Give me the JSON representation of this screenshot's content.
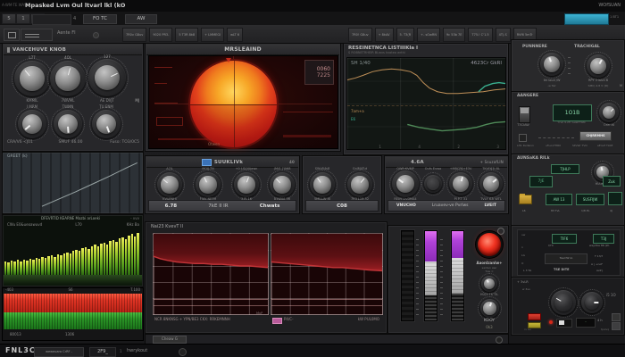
{
  "window": {
    "title_left": "A-WM-TE WAS",
    "title": "Mpasked Lvm Oul ltvarl lkl (kO",
    "title_right": "WOfSUAN"
  },
  "menubar": {
    "segments": [
      "5",
      "1",
      "0"
    ],
    "note": "4",
    "buttons": [
      "FO TC",
      "AW"
    ],
    "accent_color": "#2f9fc4",
    "accent_note": "1 BT1"
  },
  "toolbar": {
    "label": "Aente FI",
    "buttons_left": [
      "7R0v G8uv",
      "9020 PR3-",
      "5 T3R 8k8",
      "+ LMMEGI",
      "wLT 6"
    ],
    "buttons_right": [
      "7R0! G8uv",
      "+ 8kAV",
      "5. T3(R",
      "+- sOwRN",
      "9c 53b 7E",
      "T75.! C'1.5",
      "4T(.S",
      "RVf6 5mTr"
    ]
  },
  "knob_panel": {
    "header": "VANCEHUVE KNOB",
    "row1": [
      {
        "top": "L77",
        "bottom": "KMMIL",
        "angle": -40
      },
      {
        "top": "4OL",
        "bottom": "7WVML",
        "angle": 15
      },
      {
        "top": "127",
        "bottom": "AE DVJT",
        "angle": 65
      }
    ],
    "row1_note": "MJ",
    "row2": [
      {
        "top": "I MRM",
        "angle": -130
      },
      {
        "top": "TWMN",
        "angle": 175
      },
      {
        "top": "TU ENM",
        "angle": 160
      }
    ],
    "footer": [
      "CRA/V6  <J01",
      "SMUF 46.00",
      "Fuso: TO3/0C5"
    ]
  },
  "slope_panel": {
    "label": "GREET (k)"
  },
  "spectrum_panel": {
    "header": "DFEVRTID KEARNE Mazbi arLoeki",
    "corner": "- vvv",
    "sub_left": "CWu E0&ueoawuvd",
    "sub_mid": "L70",
    "sub_right": "KHz Ba"
  },
  "meter_bands": {
    "top_labels": [
      "-403",
      "S6",
      "T.100"
    ],
    "bottom_labels": [
      "80013",
      "1306"
    ],
    "red_color": "#d92c1e",
    "green_color": "#2f9e2f"
  },
  "gonio": {
    "header": "MRSLEAIND",
    "lcd_line1": "0060",
    "lcd_line2": "7225",
    "bottom_label": "Otwen"
  },
  "analyzer": {
    "header": "RESEINETNCA LISTIIIKIa I",
    "subheader": "S ROBNETRHEIR BLwvs kvateo wrthi",
    "corner_left": "SH 1/40",
    "corner_right": "4623Cr GkRI",
    "legend": [
      {
        "label": "7am+a",
        "color": "#c09058"
      },
      {
        "label": "E6",
        "color": "#3ab090"
      }
    ],
    "ticks": [
      "1",
      "4",
      "2",
      "3"
    ]
  },
  "strip_a": {
    "header": "SUUKLIVk",
    "header_value": "40",
    "knobs": [
      {
        "top": "A7IL",
        "bottom": "KVUPNHI",
        "angle": -50
      },
      {
        "top": "MOX-TN",
        "bottom": "FIAV NE3H",
        "angle": -25
      },
      {
        "top": "+0 LSUVAawn",
        "bottom": "3 PI 16",
        "angle": 20
      },
      {
        "top": "(M/S 7I068",
        "bottom": "81WVA 3R",
        "angle": -45
      }
    ],
    "readout": [
      "6.78",
      "7kE II IR",
      "Chwats"
    ]
  },
  "strip_b": {
    "knobs": [
      {
        "top": "SWvR4s8",
        "bottom": "SMILLW IB",
        "angle": -35
      },
      {
        "top": "GnlMATut",
        "bottom": "7R3 L19-32",
        "angle": 40
      }
    ],
    "readout": [
      "C08"
    ]
  },
  "strip_c": {
    "header": "4.6A",
    "header_right": "+ SsuzafLIN",
    "flat_label": "Oufs Evwo",
    "knobs": [
      {
        "top": "OWR KVMP",
        "bottom": "REAY Lh/3MA4",
        "angle": -55
      },
      {
        "top": "+MBCP6+E3V",
        "bottom": "PI P.T 31",
        "angle": 15
      },
      {
        "top": "TKVF63I 8L",
        "bottom": "TVLF 63I WTL",
        "angle": 50
      }
    ],
    "readout": [
      "VNUCHO",
      "Lruavev-ve Pvrlws",
      "LVEIT"
    ]
  },
  "red_charts": {
    "header": "Nai23 KvevT II",
    "legend_left": "NCR 8NKNSG   +   YPN/BE3 CKX:   RRKEMNNH",
    "legend_note": "MvP",
    "legend_swatch_color": "#b85a9a",
    "legend_right_1": "P4/C-",
    "legend_right_2": "kW PUL0MO",
    "footer_button": "Cheaw  G"
  },
  "monitor": {
    "button_label": "Aaonlzanlw+",
    "sub1": "sarden awr",
    "sub2": "Tuw  =",
    "knob1": {
      "angle": -30
    },
    "knob1_label": "HU/3 TS TIL",
    "knob2": {
      "angle": 20
    },
    "knob2_label": "KOOY",
    "knob2_value": "0k3"
  },
  "right_top": {
    "header_left": "PUNNNERE",
    "header_right": "TRACHIGAL",
    "knob1": {
      "angle": -20
    },
    "knob2": {
      "angle": 30
    },
    "k1_value": "Ikt loud /W",
    "k1_sub": "-w Twr",
    "k2_value": "RPY 3 loud B",
    "k2_sub": "SMC) 4.8 V: [R]",
    "note": "M"
  },
  "right_mid": {
    "header": "AANGERE",
    "toggle_label": "T3CIAW",
    "lcd": "1O1B",
    "lcd_sub": "Yrvb 9.2Tr GaWrTblN",
    "knob": {
      "angle": 45
    },
    "knob_label": "Orin at",
    "button": "CHJRRMHS",
    "row_labels": [
      "LH1 Rvdeivn",
      "uFuovTHR0",
      "SPvWr TVO",
      "eErarf TLKE"
    ]
  },
  "right_lcd": {
    "header": "AUNSaKA RILk",
    "btn1": "TJHLP",
    "knob": {
      "angle": -15
    },
    "lcd_small": "7JE",
    "knob_label": "Huur REA",
    "box1": "Zuk",
    "lcd2": "AW 13",
    "lcd3": "SUSFIJW",
    "labels": [
      "L6",
      "83 TvL",
      "1/8 PL",
      "4J"
    ]
  },
  "right_rows": {
    "l0": "uw",
    "btn1": "TIF6",
    "btn2": "T3J",
    "left_labels": [
      "n",
      "LG",
      "O"
    ],
    "t1": "I/Y4",
    "box": "Taal IW IA",
    "r1": "weyrlba 86 (W-",
    "r2": "T 13/?",
    "r3": "A | +noF",
    "b1": "L 3 TA",
    "b2": "TSE DITE",
    "b3": "AvP |"
  },
  "right_bottom": {
    "header": "+ 3vLR",
    "label": "w 3su",
    "knob1": {
      "angle": -60
    },
    "knob2": {
      "angle": 90
    },
    "icons": "i5 1O",
    "mini": "-",
    "t1": "4 h",
    "b1": "rv au",
    "b2": "tpwvq"
  },
  "statusbar": {
    "logo": "FNL3C",
    "button": "weweuara CrRF  -",
    "lcd": "2F9_",
    "sep": "1",
    "text": "hwrykout"
  },
  "chart_data": [
    {
      "id": "spectrum",
      "type": "bar",
      "values": [
        30,
        27,
        32,
        29,
        33,
        30,
        34,
        32,
        36,
        33,
        38,
        35,
        40,
        37,
        42,
        44,
        40,
        46,
        43,
        48,
        50,
        47,
        52,
        55,
        52,
        58,
        60,
        57,
        63,
        66,
        62,
        68,
        71,
        67,
        74,
        77,
        72,
        80,
        83,
        78,
        86,
        90,
        84,
        93
      ],
      "color_top": "#e9ee5c",
      "color_bottom": "#2f6a12"
    },
    {
      "id": "slope",
      "type": "line",
      "series": [
        {
          "name": "slope",
          "color": "#9aa6a6",
          "points": [
            [
              28,
              90
            ],
            [
              40,
              76
            ],
            [
              52,
              62
            ],
            [
              64,
              47
            ],
            [
              76,
              32
            ],
            [
              88,
              16
            ],
            [
              96,
              6
            ]
          ]
        }
      ]
    },
    {
      "id": "analyzer",
      "type": "line",
      "series": [
        {
          "name": "upper-trace",
          "color": "#c09058",
          "points": [
            [
              0,
              24
            ],
            [
              5,
              22
            ],
            [
              10,
              19
            ],
            [
              16,
              15
            ],
            [
              22,
              13
            ],
            [
              28,
              12
            ],
            [
              34,
              13
            ],
            [
              40,
              15
            ],
            [
              44,
              19
            ],
            [
              48,
              27
            ],
            [
              52,
              33
            ],
            [
              57,
              37
            ],
            [
              63,
              39
            ],
            [
              70,
              39
            ],
            [
              78,
              38
            ],
            [
              86,
              37
            ],
            [
              93,
              35
            ],
            [
              100,
              34
            ]
          ]
        },
        {
          "name": "lower-trace",
          "color": "#4f8a58",
          "points": [
            [
              38,
              73
            ],
            [
              45,
              76
            ],
            [
              52,
              78
            ],
            [
              60,
              80
            ],
            [
              68,
              79
            ],
            [
              75,
              78
            ],
            [
              82,
              76
            ],
            [
              88,
              73
            ],
            [
              93,
              71
            ],
            [
              100,
              70
            ]
          ]
        },
        {
          "name": "teal-trace",
          "color": "#3ab090",
          "points": [
            [
              83,
              37
            ],
            [
              87,
              31
            ],
            [
              92,
              28
            ],
            [
              96,
              27
            ],
            [
              100,
              28
            ]
          ]
        }
      ]
    },
    {
      "id": "red_left",
      "type": "area",
      "color": "#a82226",
      "points": [
        [
          0,
          28
        ],
        [
          6,
          31
        ],
        [
          12,
          33
        ],
        [
          20,
          35
        ],
        [
          28,
          36
        ],
        [
          36,
          37
        ],
        [
          44,
          37
        ],
        [
          52,
          38
        ],
        [
          60,
          38
        ],
        [
          68,
          39
        ],
        [
          76,
          40
        ],
        [
          84,
          40
        ],
        [
          92,
          41
        ],
        [
          100,
          42
        ]
      ]
    },
    {
      "id": "red_right",
      "type": "area",
      "color": "#a82226",
      "points": [
        [
          0,
          35
        ],
        [
          8,
          36
        ],
        [
          16,
          37
        ],
        [
          24,
          38
        ],
        [
          32,
          39
        ],
        [
          40,
          40
        ],
        [
          48,
          41
        ],
        [
          56,
          42
        ],
        [
          64,
          42
        ],
        [
          72,
          43
        ],
        [
          80,
          44
        ],
        [
          88,
          45
        ],
        [
          100,
          46
        ]
      ]
    },
    {
      "id": "meters",
      "type": "meter",
      "values": [
        [
          [
            "dark",
            100
          ]
        ],
        [
          [
            "purple",
            34
          ],
          [
            "silver",
            38
          ],
          [
            "hatch",
            28
          ]
        ],
        [
          [
            "purple",
            30
          ],
          [
            "silver",
            40
          ],
          [
            "hatch",
            30
          ]
        ]
      ]
    }
  ]
}
